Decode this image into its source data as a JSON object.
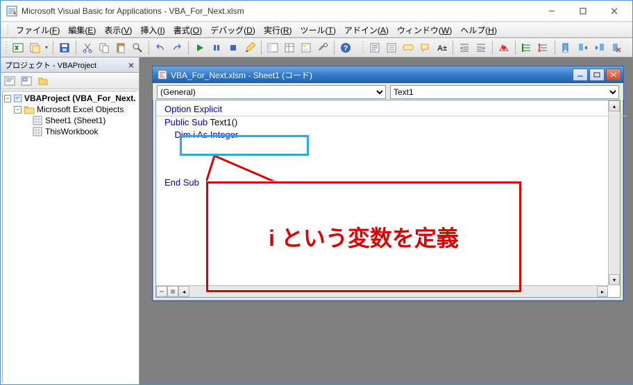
{
  "window": {
    "title": "Microsoft Visual Basic for Applications - VBA_For_Next.xlsm"
  },
  "menu": {
    "items": [
      {
        "label": "ファイル",
        "key": "F"
      },
      {
        "label": "編集",
        "key": "E"
      },
      {
        "label": "表示",
        "key": "V"
      },
      {
        "label": "挿入",
        "key": "I"
      },
      {
        "label": "書式",
        "key": "O"
      },
      {
        "label": "デバッグ",
        "key": "D"
      },
      {
        "label": "実行",
        "key": "R"
      },
      {
        "label": "ツール",
        "key": "T"
      },
      {
        "label": "アドイン",
        "key": "A"
      },
      {
        "label": "ウィンドウ",
        "key": "W"
      },
      {
        "label": "ヘルプ",
        "key": "H"
      }
    ]
  },
  "project": {
    "title": "プロジェクト - VBAProject",
    "tree": {
      "root": "VBAProject (VBA_For_Next.xlsm)",
      "folder": "Microsoft Excel Objects",
      "sheet": "Sheet1 (Sheet1)",
      "workbook": "ThisWorkbook"
    }
  },
  "codewin": {
    "title": "VBA_For_Next.xlsm - Sheet1 (コード)",
    "left_dd": "(General)",
    "right_dd": "Text1",
    "code": {
      "l1": "Option Explicit",
      "l2a": "Public Sub",
      "l2b": " Text1()",
      "l3a": "    Dim",
      "l3b": " i ",
      "l3c": "As Integer",
      "l4": "End Sub"
    }
  },
  "annotation": {
    "callout": "i という変数を定義"
  }
}
